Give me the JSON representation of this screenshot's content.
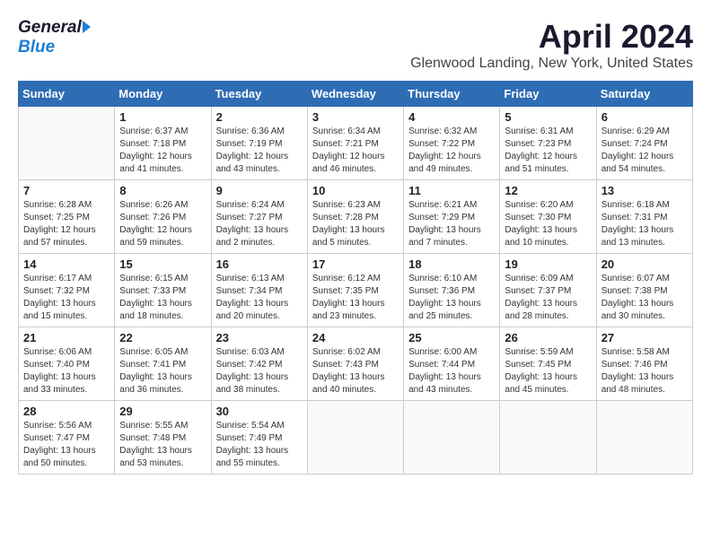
{
  "header": {
    "logo_general": "General",
    "logo_blue": "Blue",
    "main_title": "April 2024",
    "subtitle": "Glenwood Landing, New York, United States"
  },
  "calendar": {
    "days_of_week": [
      "Sunday",
      "Monday",
      "Tuesday",
      "Wednesday",
      "Thursday",
      "Friday",
      "Saturday"
    ],
    "weeks": [
      [
        {
          "day": "",
          "info": ""
        },
        {
          "day": "1",
          "info": "Sunrise: 6:37 AM\nSunset: 7:18 PM\nDaylight: 12 hours\nand 41 minutes."
        },
        {
          "day": "2",
          "info": "Sunrise: 6:36 AM\nSunset: 7:19 PM\nDaylight: 12 hours\nand 43 minutes."
        },
        {
          "day": "3",
          "info": "Sunrise: 6:34 AM\nSunset: 7:21 PM\nDaylight: 12 hours\nand 46 minutes."
        },
        {
          "day": "4",
          "info": "Sunrise: 6:32 AM\nSunset: 7:22 PM\nDaylight: 12 hours\nand 49 minutes."
        },
        {
          "day": "5",
          "info": "Sunrise: 6:31 AM\nSunset: 7:23 PM\nDaylight: 12 hours\nand 51 minutes."
        },
        {
          "day": "6",
          "info": "Sunrise: 6:29 AM\nSunset: 7:24 PM\nDaylight: 12 hours\nand 54 minutes."
        }
      ],
      [
        {
          "day": "7",
          "info": "Sunrise: 6:28 AM\nSunset: 7:25 PM\nDaylight: 12 hours\nand 57 minutes."
        },
        {
          "day": "8",
          "info": "Sunrise: 6:26 AM\nSunset: 7:26 PM\nDaylight: 12 hours\nand 59 minutes."
        },
        {
          "day": "9",
          "info": "Sunrise: 6:24 AM\nSunset: 7:27 PM\nDaylight: 13 hours\nand 2 minutes."
        },
        {
          "day": "10",
          "info": "Sunrise: 6:23 AM\nSunset: 7:28 PM\nDaylight: 13 hours\nand 5 minutes."
        },
        {
          "day": "11",
          "info": "Sunrise: 6:21 AM\nSunset: 7:29 PM\nDaylight: 13 hours\nand 7 minutes."
        },
        {
          "day": "12",
          "info": "Sunrise: 6:20 AM\nSunset: 7:30 PM\nDaylight: 13 hours\nand 10 minutes."
        },
        {
          "day": "13",
          "info": "Sunrise: 6:18 AM\nSunset: 7:31 PM\nDaylight: 13 hours\nand 13 minutes."
        }
      ],
      [
        {
          "day": "14",
          "info": "Sunrise: 6:17 AM\nSunset: 7:32 PM\nDaylight: 13 hours\nand 15 minutes."
        },
        {
          "day": "15",
          "info": "Sunrise: 6:15 AM\nSunset: 7:33 PM\nDaylight: 13 hours\nand 18 minutes."
        },
        {
          "day": "16",
          "info": "Sunrise: 6:13 AM\nSunset: 7:34 PM\nDaylight: 13 hours\nand 20 minutes."
        },
        {
          "day": "17",
          "info": "Sunrise: 6:12 AM\nSunset: 7:35 PM\nDaylight: 13 hours\nand 23 minutes."
        },
        {
          "day": "18",
          "info": "Sunrise: 6:10 AM\nSunset: 7:36 PM\nDaylight: 13 hours\nand 25 minutes."
        },
        {
          "day": "19",
          "info": "Sunrise: 6:09 AM\nSunset: 7:37 PM\nDaylight: 13 hours\nand 28 minutes."
        },
        {
          "day": "20",
          "info": "Sunrise: 6:07 AM\nSunset: 7:38 PM\nDaylight: 13 hours\nand 30 minutes."
        }
      ],
      [
        {
          "day": "21",
          "info": "Sunrise: 6:06 AM\nSunset: 7:40 PM\nDaylight: 13 hours\nand 33 minutes."
        },
        {
          "day": "22",
          "info": "Sunrise: 6:05 AM\nSunset: 7:41 PM\nDaylight: 13 hours\nand 36 minutes."
        },
        {
          "day": "23",
          "info": "Sunrise: 6:03 AM\nSunset: 7:42 PM\nDaylight: 13 hours\nand 38 minutes."
        },
        {
          "day": "24",
          "info": "Sunrise: 6:02 AM\nSunset: 7:43 PM\nDaylight: 13 hours\nand 40 minutes."
        },
        {
          "day": "25",
          "info": "Sunrise: 6:00 AM\nSunset: 7:44 PM\nDaylight: 13 hours\nand 43 minutes."
        },
        {
          "day": "26",
          "info": "Sunrise: 5:59 AM\nSunset: 7:45 PM\nDaylight: 13 hours\nand 45 minutes."
        },
        {
          "day": "27",
          "info": "Sunrise: 5:58 AM\nSunset: 7:46 PM\nDaylight: 13 hours\nand 48 minutes."
        }
      ],
      [
        {
          "day": "28",
          "info": "Sunrise: 5:56 AM\nSunset: 7:47 PM\nDaylight: 13 hours\nand 50 minutes."
        },
        {
          "day": "29",
          "info": "Sunrise: 5:55 AM\nSunset: 7:48 PM\nDaylight: 13 hours\nand 53 minutes."
        },
        {
          "day": "30",
          "info": "Sunrise: 5:54 AM\nSunset: 7:49 PM\nDaylight: 13 hours\nand 55 minutes."
        },
        {
          "day": "",
          "info": ""
        },
        {
          "day": "",
          "info": ""
        },
        {
          "day": "",
          "info": ""
        },
        {
          "day": "",
          "info": ""
        }
      ]
    ]
  }
}
